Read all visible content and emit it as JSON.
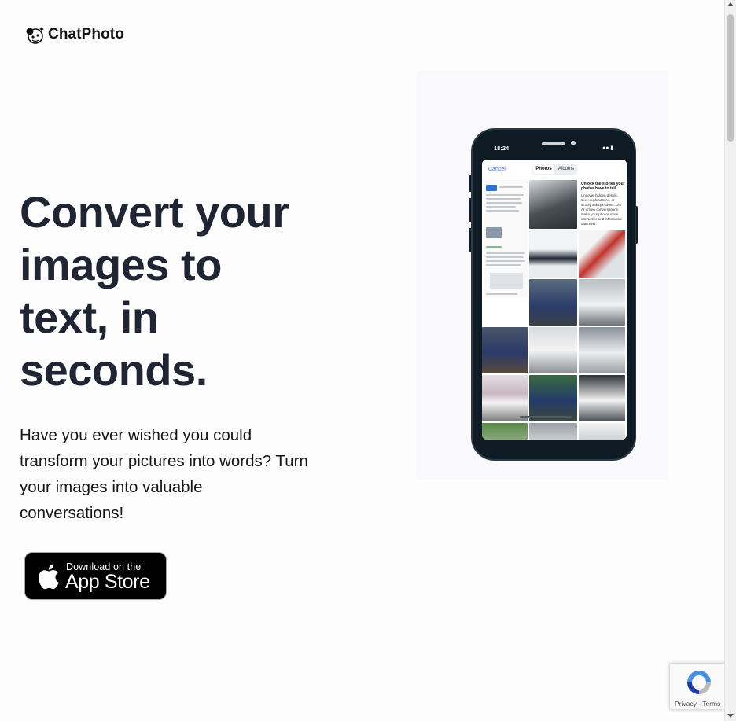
{
  "header": {
    "brand": "ChatPhoto"
  },
  "hero": {
    "title_lines": [
      "Convert your",
      "images to",
      "text, in",
      "seconds."
    ],
    "subtitle": "Have you ever wished you could transform your pictures into words? Turn your images into valuable conversations!"
  },
  "appstore": {
    "small_label": "Download on the",
    "big_label": "App Store"
  },
  "phone": {
    "time": "18:24",
    "cancel": "Cancel",
    "tab_photos": "Photos",
    "tab_albums": "Albums",
    "blurb_title": "Unlock the stories your photos have to tell.",
    "blurb_body": "Uncover hidden details, seek explanations, or simply ask questions. Our AI-driven conversations make your photos more interactive and informative than ever."
  },
  "recaptcha": {
    "privacy": "Privacy",
    "sep": " - ",
    "terms": "Terms"
  },
  "colors": {
    "heading": "#1f2533",
    "body": "#161616",
    "button_bg": "#000000",
    "link": "#2f6fd6"
  }
}
